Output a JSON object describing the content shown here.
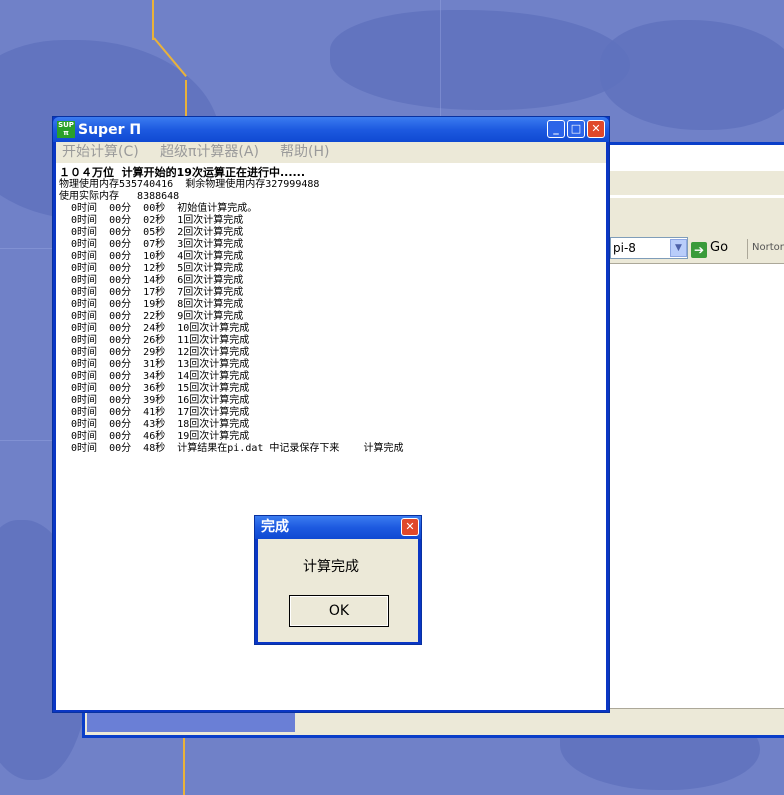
{
  "superpi": {
    "title": "Super Π",
    "logo_text": "SUPER",
    "menu": [
      "开始计算(C)",
      "超级π计算器(A)",
      "帮助(H)"
    ],
    "log": [
      "１０４万位  计算开始的19次运算正在进行中......",
      "物理使用内存535740416  剩余物理使用内存327999488",
      "使用实际内存   8388648",
      "  0时间  00分  00秒  初始值计算完成。",
      "  0时间  00分  02秒  1回次计算完成",
      "  0时间  00分  05秒  2回次计算完成",
      "  0时间  00分  07秒  3回次计算完成",
      "  0时间  00分  10秒  4回次计算完成",
      "  0时间  00分  12秒  5回次计算完成",
      "  0时间  00分  14秒  6回次计算完成",
      "  0时间  00分  17秒  7回次计算完成",
      "  0时间  00分  19秒  8回次计算完成",
      "  0时间  00分  22秒  9回次计算完成",
      "  0时间  00分  24秒  10回次计算完成",
      "  0时间  00分  26秒  11回次计算完成",
      "  0时间  00分  29秒  12回次计算完成",
      "  0时间  00分  31秒  13回次计算完成",
      "  0时间  00分  34秒  14回次计算完成",
      "  0时间  00分  36秒  15回次计算完成",
      "  0时间  00分  39秒  16回次计算完成",
      "  0时间  00分  41秒  17回次计算完成",
      "  0时间  00分  43秒  18回次计算完成",
      "  0时间  00分  46秒  19回次计算完成",
      "  0时间  00分  48秒  计算结果在pi.dat 中记录保存下来    计算完成"
    ]
  },
  "dialog": {
    "title": "完成",
    "message": "计算完成",
    "ok_label": "OK"
  },
  "background_window": {
    "address_value": "pi-8",
    "go_label": "Go",
    "norton_label": "Norton"
  },
  "colors": {
    "titlebar": "#1d5ae0",
    "wallpaper": "#7081c8",
    "menu_bg": "#ece9d8"
  }
}
